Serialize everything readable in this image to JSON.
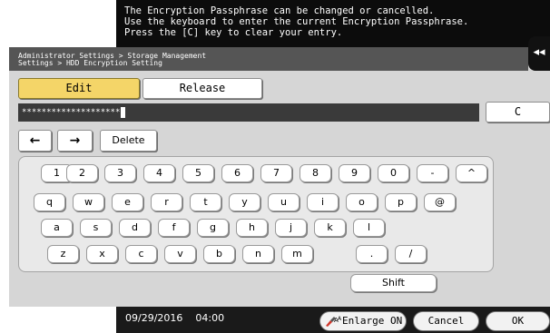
{
  "message": {
    "lines": [
      "The Encryption Passphrase can be changed or cancelled.",
      "Use the keyboard to enter the current Encryption Passphrase.",
      "Press the [C] key to clear your entry."
    ]
  },
  "breadcrumb": {
    "line1": "Administrator Settings > Storage Management",
    "line2": "Settings > HDD Encryption Setting"
  },
  "collapse_glyph": "◂◂",
  "tabs": {
    "edit": "Edit",
    "release": "Release"
  },
  "entry": {
    "value": "********************"
  },
  "clear_key": "C",
  "nav": {
    "left": "←",
    "right": "→",
    "delete": "Delete"
  },
  "keyboard": {
    "row1": [
      "1",
      "2",
      "3",
      "4",
      "5",
      "6",
      "7",
      "8",
      "9",
      "0",
      "-",
      "^"
    ],
    "row2": [
      "q",
      "w",
      "e",
      "r",
      "t",
      "y",
      "u",
      "i",
      "o",
      "p",
      "@"
    ],
    "row3": [
      "a",
      "s",
      "d",
      "f",
      "g",
      "h",
      "j",
      "k",
      "l"
    ],
    "row4": [
      "z",
      "x",
      "c",
      "v",
      "b",
      "n",
      "m",
      ".",
      "/"
    ],
    "shift": "Shift"
  },
  "status": {
    "date": "09/29/2016",
    "time": "04:00"
  },
  "footer": {
    "enlarge": "Enlarge ON",
    "cancel": "Cancel",
    "ok": "OK"
  },
  "colors": {
    "active_tab": "#f4d568",
    "panel": "#d6d6d6",
    "header": "#0c0c0c"
  }
}
